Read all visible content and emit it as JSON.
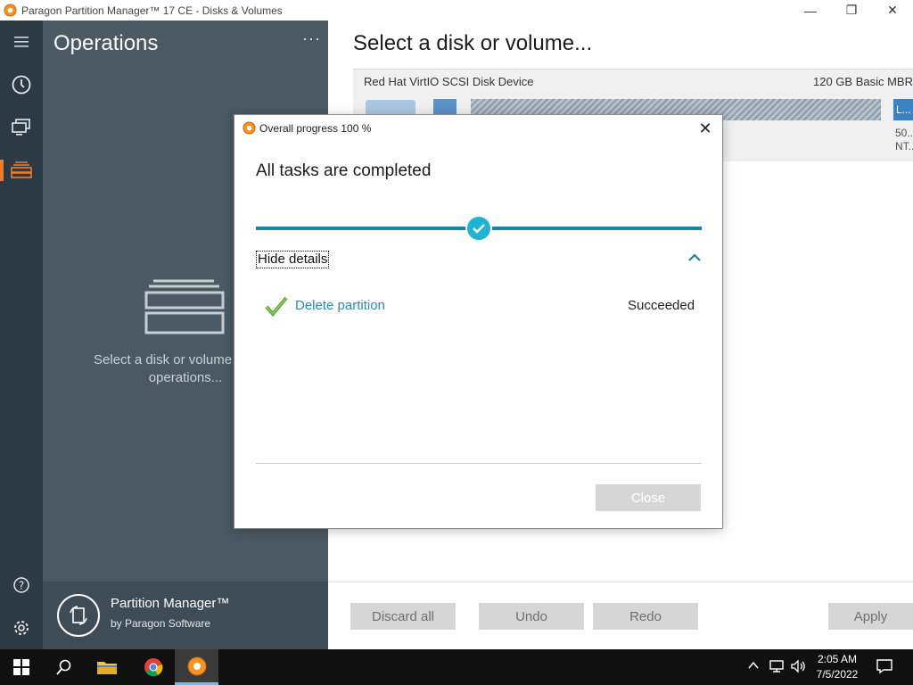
{
  "window": {
    "title": "Paragon Partition Manager™ 17 CE - Disks & Volumes",
    "controls": {
      "minimize": "—",
      "maximize": "❐",
      "close": "✕"
    }
  },
  "sidebar": {
    "items": [
      {
        "icon": "hamburger-menu-icon"
      },
      {
        "icon": "history-clock-icon"
      },
      {
        "icon": "monitor-icon"
      },
      {
        "icon": "disks-volumes-icon",
        "active": true
      },
      {
        "icon": "help-icon"
      },
      {
        "icon": "settings-gear-icon"
      }
    ],
    "accent": "#f07b2a"
  },
  "operations": {
    "title": "Operations",
    "more": "···",
    "empty_text": "Select a disk or volume to view\noperations...",
    "brand_name": "Partition Manager™",
    "brand_sub": "by Paragon Software"
  },
  "main": {
    "heading": "Select a disk or volume...",
    "disk": {
      "name": "Red Hat VirtIO SCSI Disk Device",
      "info": "120 GB Basic MBR",
      "volume_label": "L...",
      "volume_size": "50...",
      "volume_fs": "NT..."
    },
    "buttons": {
      "discard_all": "Discard all",
      "undo": "Undo",
      "redo": "Redo",
      "apply": "Apply"
    }
  },
  "dialog": {
    "title": "Overall progress 100 %",
    "close_icon": "✕",
    "heading": "All tasks are completed",
    "progress": 1.0,
    "details_toggle": "Hide details",
    "tasks": [
      {
        "name": "Delete partition",
        "status": "Succeeded"
      }
    ],
    "close_button": "Close",
    "colors": {
      "progress": "#1b7fa8",
      "check": "#1fb3d4",
      "link": "#2a8cb5"
    }
  },
  "taskbar": {
    "time": "2:05 AM",
    "date": "7/5/2022"
  }
}
